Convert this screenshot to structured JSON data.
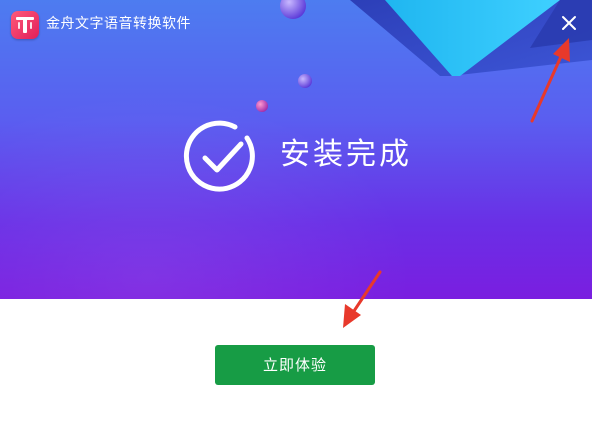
{
  "window": {
    "title": "金舟文字语音转换软件",
    "logo_icon": "app-logo-icon",
    "close_icon": "close-icon"
  },
  "banner": {
    "status_text": "安装完成",
    "status_icon": "check-circle-icon",
    "gradient_colors": [
      "#4d7cf0",
      "#6a2fe6",
      "#7a1ee0"
    ]
  },
  "actions": {
    "primary_label": "立即体验",
    "primary_color": "#179c45"
  },
  "annotations": {
    "arrow_color": "#e8392b",
    "arrows": [
      "arrow-to-close",
      "arrow-to-experience-button"
    ]
  }
}
